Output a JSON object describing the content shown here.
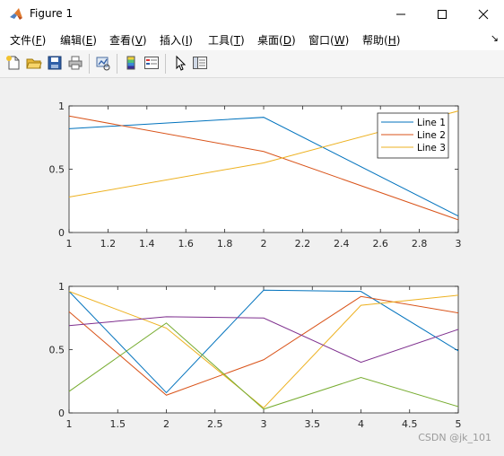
{
  "window": {
    "title": "Figure 1",
    "controls": {
      "minimize": "minimize-icon",
      "maximize": "maximize-icon",
      "close": "close-icon"
    }
  },
  "menu": {
    "items": [
      {
        "text": "文件(",
        "mnemonic": "F",
        "close": ")"
      },
      {
        "text": "编辑(",
        "mnemonic": "E",
        "close": ")"
      },
      {
        "text": "查看(",
        "mnemonic": "V",
        "close": ")"
      },
      {
        "text": "插入(",
        "mnemonic": "I",
        "close": ")"
      },
      {
        "text": "工具(",
        "mnemonic": "T",
        "close": ")"
      },
      {
        "text": "桌面(",
        "mnemonic": "D",
        "close": ")"
      },
      {
        "text": "窗口(",
        "mnemonic": "W",
        "close": ")"
      },
      {
        "text": "帮助(",
        "mnemonic": "H",
        "close": ")"
      }
    ],
    "overflow": "↘"
  },
  "toolbar": {
    "icons": [
      "new-figure-icon",
      "open-file-icon",
      "save-icon",
      "print-icon",
      "link-plot-icon",
      "insert-colorbar-icon",
      "insert-legend-icon",
      "edit-plot-icon",
      "property-inspector-icon"
    ]
  },
  "watermark": "CSDN @jk_101",
  "chart_data": [
    {
      "type": "line",
      "title": "",
      "xlabel": "",
      "ylabel": "",
      "xlim": [
        1,
        3
      ],
      "ylim": [
        0,
        1
      ],
      "xticks": [
        "1",
        "1.2",
        "1.4",
        "1.6",
        "1.8",
        "2",
        "2.2",
        "2.4",
        "2.6",
        "2.8",
        "3"
      ],
      "yticks": [
        "0",
        "0.5",
        "1"
      ],
      "grid": false,
      "legend": "top-right",
      "x": [
        1,
        2,
        3
      ],
      "series": [
        {
          "name": "Line 1",
          "color": "#0072BD",
          "values": [
            0.82,
            0.91,
            0.13
          ]
        },
        {
          "name": "Line 2",
          "color": "#D95319",
          "values": [
            0.92,
            0.64,
            0.1
          ]
        },
        {
          "name": "Line 3",
          "color": "#EDB120",
          "values": [
            0.28,
            0.55,
            0.96
          ]
        }
      ]
    },
    {
      "type": "line",
      "title": "",
      "xlabel": "",
      "ylabel": "",
      "xlim": [
        1,
        5
      ],
      "ylim": [
        0,
        1
      ],
      "xticks": [
        "1",
        "1.5",
        "2",
        "2.5",
        "3",
        "3.5",
        "4",
        "4.5",
        "5"
      ],
      "yticks": [
        "0",
        "0.5",
        "1"
      ],
      "grid": false,
      "x": [
        1,
        2,
        3,
        4,
        5
      ],
      "series": [
        {
          "color": "#0072BD",
          "values": [
            0.96,
            0.16,
            0.97,
            0.96,
            0.49
          ]
        },
        {
          "color": "#D95319",
          "values": [
            0.8,
            0.14,
            0.42,
            0.92,
            0.79
          ]
        },
        {
          "color": "#EDB120",
          "values": [
            0.96,
            0.67,
            0.04,
            0.85,
            0.93
          ]
        },
        {
          "color": "#7E2F8E",
          "values": [
            0.69,
            0.76,
            0.75,
            0.4,
            0.66
          ]
        },
        {
          "color": "#77AC30",
          "values": [
            0.17,
            0.71,
            0.03,
            0.28,
            0.05
          ]
        }
      ]
    }
  ]
}
